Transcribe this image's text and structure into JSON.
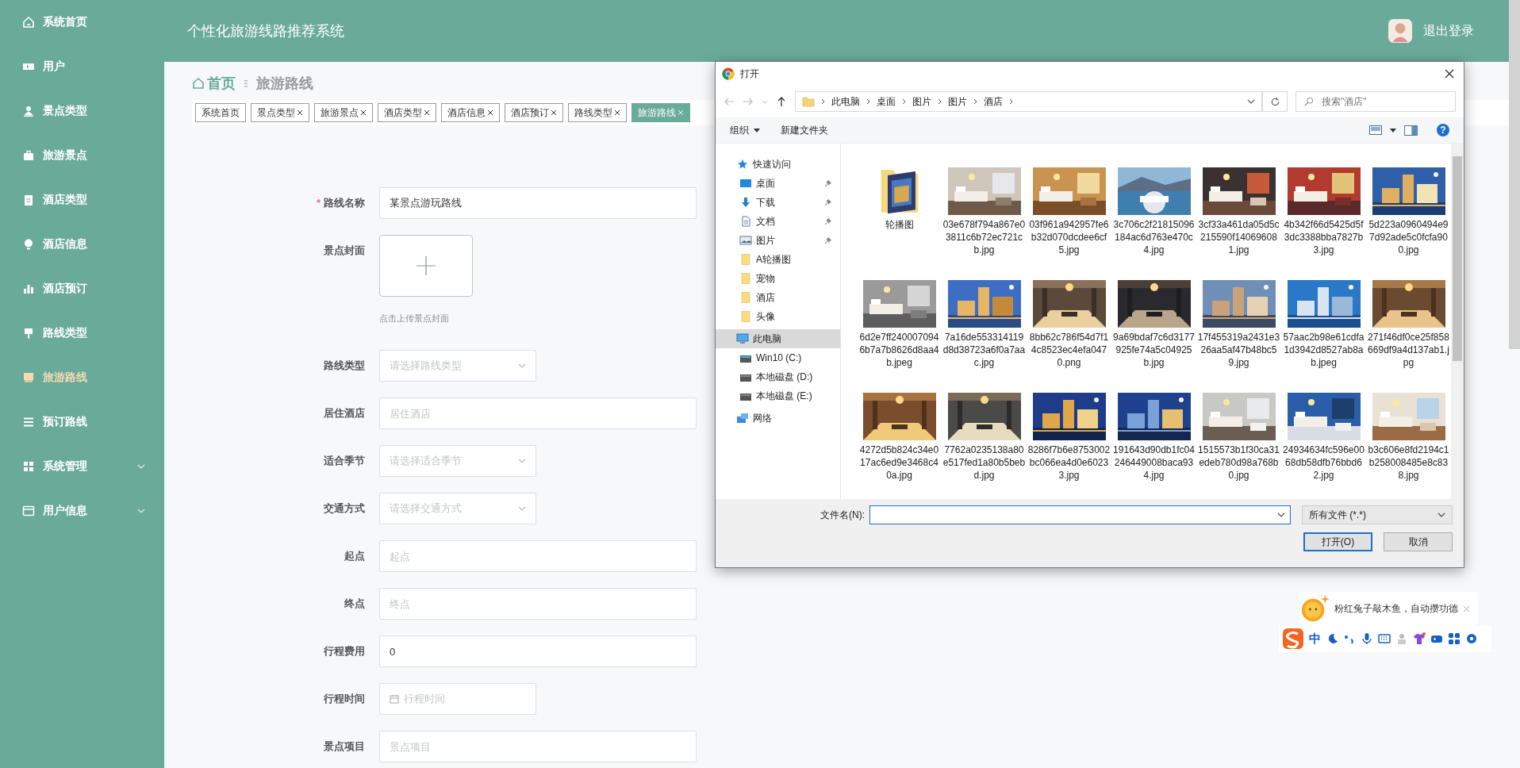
{
  "header": {
    "title": "个性化旅游线路推荐系统",
    "logout": "退出登录"
  },
  "sidebar": {
    "items": [
      {
        "label": "系统首页",
        "kind": "link",
        "selected": false
      },
      {
        "label": "用户",
        "kind": "link",
        "selected": false
      },
      {
        "label": "景点类型",
        "kind": "link",
        "selected": false
      },
      {
        "label": "旅游景点",
        "kind": "link",
        "selected": false
      },
      {
        "label": "酒店类型",
        "kind": "link",
        "selected": false
      },
      {
        "label": "酒店信息",
        "kind": "link",
        "selected": false
      },
      {
        "label": "酒店预订",
        "kind": "link",
        "selected": false
      },
      {
        "label": "路线类型",
        "kind": "link",
        "selected": false
      },
      {
        "label": "旅游路线",
        "kind": "link",
        "selected": true
      },
      {
        "label": "预订路线",
        "kind": "link",
        "selected": false
      },
      {
        "label": "系统管理",
        "kind": "group",
        "selected": false
      },
      {
        "label": "用户信息",
        "kind": "group",
        "selected": false
      }
    ]
  },
  "breadcrumb": {
    "home": "首页",
    "current": "旅游路线"
  },
  "tabs": [
    {
      "label": "系统首页",
      "closable": false,
      "selected": false
    },
    {
      "label": "景点类型",
      "closable": true,
      "selected": false
    },
    {
      "label": "旅游景点",
      "closable": true,
      "selected": false
    },
    {
      "label": "酒店类型",
      "closable": true,
      "selected": false
    },
    {
      "label": "酒店信息",
      "closable": true,
      "selected": false
    },
    {
      "label": "酒店预订",
      "closable": true,
      "selected": false
    },
    {
      "label": "路线类型",
      "closable": true,
      "selected": false
    },
    {
      "label": "旅游路线",
      "closable": true,
      "selected": true
    }
  ],
  "form": {
    "fields": [
      {
        "kind": "text",
        "label": "路线名称",
        "required_mark": "*",
        "value": "某景点游玩路线"
      },
      {
        "kind": "upload",
        "label": "景点封面",
        "hint": "点击上传景点封面"
      },
      {
        "kind": "select",
        "label": "路线类型",
        "placeholder": "请选择路线类型"
      },
      {
        "kind": "text",
        "label": "居住酒店",
        "placeholder": "居住酒店"
      },
      {
        "kind": "select",
        "label": "适合季节",
        "placeholder": "请选择适合季节"
      },
      {
        "kind": "select",
        "label": "交通方式",
        "placeholder": "请选择交通方式"
      },
      {
        "kind": "text",
        "label": "起点",
        "placeholder": "起点"
      },
      {
        "kind": "text",
        "label": "终点",
        "placeholder": "终点"
      },
      {
        "kind": "text",
        "label": "行程费用",
        "value": "0"
      },
      {
        "kind": "date",
        "label": "行程时间",
        "placeholder": "行程时间"
      },
      {
        "kind": "text",
        "label": "景点项目",
        "placeholder": "景点项目"
      }
    ]
  },
  "dialog": {
    "title": "打开",
    "path": [
      "此电脑",
      "桌面",
      "图片",
      "图片",
      "酒店"
    ],
    "search_placeholder": "搜索\"酒店\"",
    "toolbar": [
      "组织",
      "新建文件夹"
    ],
    "help": "?",
    "nav": [
      {
        "label": "快速访问",
        "selected": false,
        "children": [
          {
            "label": "桌面",
            "pinned": true,
            "selected": false
          },
          {
            "label": "下载",
            "pinned": true,
            "selected": false
          },
          {
            "label": "文档",
            "pinned": true,
            "selected": false
          },
          {
            "label": "图片",
            "pinned": true,
            "selected": false
          },
          {
            "label": "A轮播图",
            "pinned": false,
            "selected": false
          },
          {
            "label": "宠物",
            "pinned": false,
            "selected": false
          },
          {
            "label": "酒店",
            "pinned": false,
            "selected": false
          },
          {
            "label": "头像",
            "pinned": false,
            "selected": false
          }
        ]
      },
      {
        "label": "此电脑",
        "selected": true,
        "children": [
          {
            "label": "Win10 (C:)",
            "pinned": false,
            "selected": false
          },
          {
            "label": "本地磁盘 (D:)",
            "pinned": false,
            "selected": false
          },
          {
            "label": "本地磁盘 (E:)",
            "pinned": false,
            "selected": false
          }
        ]
      },
      {
        "label": "网络",
        "selected": false
      }
    ],
    "files": [
      {
        "kind": "folder",
        "name": "轮播图"
      },
      {
        "kind": "picture",
        "name": "03e678f794a867e03811c6b72ec721cb.jpg"
      },
      {
        "kind": "picture",
        "name": "03f961a942957fe6b32d070dcdee6cf5.jpg"
      },
      {
        "kind": "picture",
        "name": "3c706c2f21815096184ac6d763e470c4.jpg"
      },
      {
        "kind": "picture",
        "name": "3cf33a461da05d5c215590f140696081.jpg"
      },
      {
        "kind": "picture",
        "name": "4b342f66d5425d5f3dc3388bba7827b3.jpg"
      },
      {
        "kind": "picture",
        "name": "5d223a0960494e97d92ade5c0fcfa900.jpg"
      },
      {
        "kind": "picture",
        "name": "6d2e7ff2400070946b7a7b8626d8aa4b.jpeg"
      },
      {
        "kind": "picture",
        "name": "7a16de553314119d8d38723a6f0a7aac.jpg"
      },
      {
        "kind": "picture",
        "name": "8bb62c786f54d7f14c8523ec4efa0470.png"
      },
      {
        "kind": "picture",
        "name": "9a69bdaf7c6d3177925fe74a5c04925b.jpg"
      },
      {
        "kind": "picture",
        "name": "17f455319a2431e326aa5af47b48bc59.jpg"
      },
      {
        "kind": "picture",
        "name": "57aac2b98e61cdfa1d3942d8527ab8ab.jpeg"
      },
      {
        "kind": "picture",
        "name": "271f46df0ce25f858669df9a4d137ab1.jpg"
      },
      {
        "kind": "picture",
        "name": "4272d5b824c34e017ac6ed9e3468c40a.jpg"
      },
      {
        "kind": "picture",
        "name": "7762a0235138a80e517fed1a80b5bebd.jpg"
      },
      {
        "kind": "picture",
        "name": "8286f7b6e8753002bc066ea4d0e60233.jpg"
      },
      {
        "kind": "picture",
        "name": "191643d90db1fc04246449008baca934.jpg"
      },
      {
        "kind": "picture",
        "name": "1515573b1f30ca31edeb780d98a768b0.jpg"
      },
      {
        "kind": "picture",
        "name": "24934634fc596e0068db58dfb76bbd62.jpg"
      },
      {
        "kind": "picture",
        "name": "b3c606e8fd2194c1b258008485e8c838.jpg"
      }
    ],
    "filename_label": "文件名(N):",
    "filetype": "所有文件 (*.*)",
    "buttons": [
      {
        "label": "打开(O)",
        "default": true
      },
      {
        "label": "取消",
        "default": false
      }
    ]
  },
  "ime": {
    "bubble": "粉红兔子敲木鱼，自动攒功德",
    "mode": "中"
  }
}
